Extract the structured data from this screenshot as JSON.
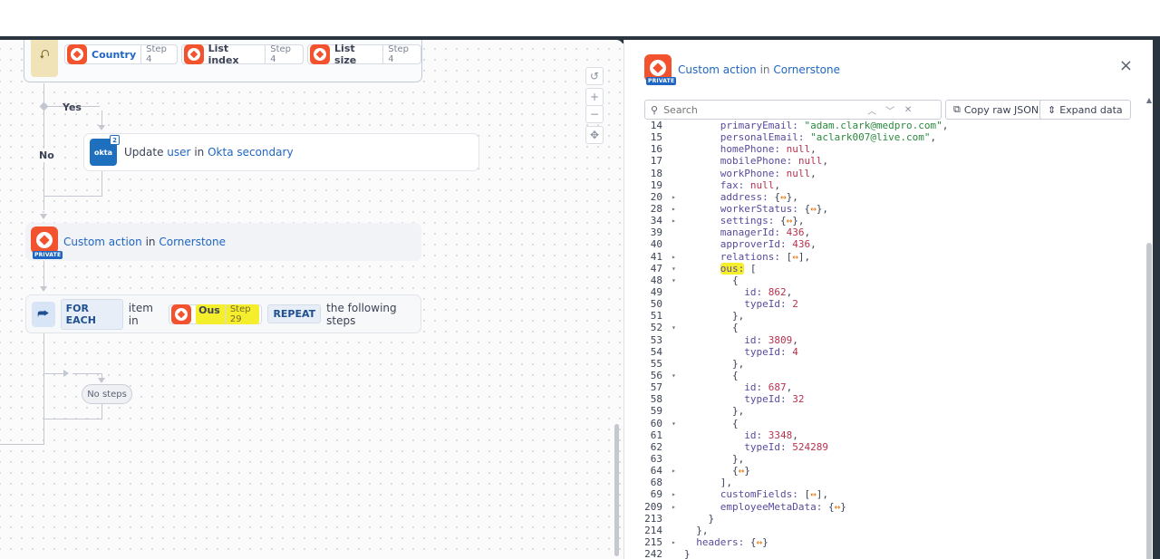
{
  "canvas": {
    "top_node": {
      "pills": [
        {
          "name": "Country",
          "step": "Step 4"
        },
        {
          "name": "List index",
          "step": "Step 4"
        },
        {
          "name": "List size",
          "step": "Step 4"
        }
      ]
    },
    "branch": {
      "yes_label": "Yes",
      "no_label": "No"
    },
    "okta_step": {
      "prefix": "Update",
      "object": "user",
      "in": "in",
      "app": "Okta secondary",
      "logo_text": "okta",
      "badge": "2"
    },
    "custom_action": {
      "prefix": "Custom action",
      "in": "in",
      "app": "Cornerstone",
      "private": "PRIVATE"
    },
    "foreach": {
      "kw1": "FOR EACH",
      "item": "item in",
      "pill_name": "Ous",
      "pill_step": "Step 29",
      "kw2": "REPEAT",
      "suffix": "the following steps"
    },
    "no_steps": "No steps",
    "controls": [
      "↺",
      "+",
      "−",
      "✥"
    ]
  },
  "panel": {
    "title_prefix": "Custom action",
    "title_in": "in",
    "title_app": "Cornerstone",
    "private": "PRIVATE",
    "search_placeholder": "Search",
    "copy_button": "Copy raw JSON",
    "expand_button": "Expand data",
    "close": "×",
    "lines": [
      {
        "n": "14",
        "t": "",
        "i": 6,
        "parts": [
          [
            "k",
            "primaryEmail: "
          ],
          [
            "s",
            "\"adam.clark@medpro.com\""
          ],
          [
            "p",
            ","
          ]
        ]
      },
      {
        "n": "15",
        "t": "",
        "i": 6,
        "parts": [
          [
            "k",
            "personalEmail: "
          ],
          [
            "s",
            "\"aclark007@live.com\""
          ],
          [
            "p",
            ","
          ]
        ]
      },
      {
        "n": "16",
        "t": "",
        "i": 6,
        "parts": [
          [
            "k",
            "homePhone: "
          ],
          [
            "n",
            "null"
          ],
          [
            "p",
            ","
          ]
        ]
      },
      {
        "n": "17",
        "t": "",
        "i": 6,
        "parts": [
          [
            "k",
            "mobilePhone: "
          ],
          [
            "n",
            "null"
          ],
          [
            "p",
            ","
          ]
        ]
      },
      {
        "n": "18",
        "t": "",
        "i": 6,
        "parts": [
          [
            "k",
            "workPhone: "
          ],
          [
            "n",
            "null"
          ],
          [
            "p",
            ","
          ]
        ]
      },
      {
        "n": "19",
        "t": "",
        "i": 6,
        "parts": [
          [
            "k",
            "fax: "
          ],
          [
            "n",
            "null"
          ],
          [
            "p",
            ","
          ]
        ]
      },
      {
        "n": "20",
        "t": "▸",
        "i": 6,
        "parts": [
          [
            "k",
            "address: "
          ],
          [
            "p",
            "{"
          ],
          [
            "o",
            "↔"
          ],
          [
            "p",
            "},"
          ]
        ]
      },
      {
        "n": "28",
        "t": "▸",
        "i": 6,
        "parts": [
          [
            "k",
            "workerStatus: "
          ],
          [
            "p",
            "{"
          ],
          [
            "o",
            "↔"
          ],
          [
            "p",
            "},"
          ]
        ]
      },
      {
        "n": "34",
        "t": "▸",
        "i": 6,
        "parts": [
          [
            "k",
            "settings: "
          ],
          [
            "p",
            "{"
          ],
          [
            "o",
            "↔"
          ],
          [
            "p",
            "},"
          ]
        ]
      },
      {
        "n": "39",
        "t": "",
        "i": 6,
        "parts": [
          [
            "k",
            "managerId: "
          ],
          [
            "n",
            "436"
          ],
          [
            "p",
            ","
          ]
        ]
      },
      {
        "n": "40",
        "t": "",
        "i": 6,
        "parts": [
          [
            "k",
            "approverId: "
          ],
          [
            "n",
            "436"
          ],
          [
            "p",
            ","
          ]
        ]
      },
      {
        "n": "41",
        "t": "▸",
        "i": 6,
        "parts": [
          [
            "k",
            "relations: "
          ],
          [
            "p",
            "["
          ],
          [
            "o",
            "↔"
          ],
          [
            "p",
            "],"
          ]
        ]
      },
      {
        "n": "47",
        "t": "▾",
        "i": 6,
        "parts": [
          [
            "h",
            "ous:"
          ],
          [
            "p",
            " ["
          ]
        ]
      },
      {
        "n": "48",
        "t": "▾",
        "i": 8,
        "parts": [
          [
            "p",
            "{"
          ]
        ]
      },
      {
        "n": "49",
        "t": "",
        "i": 10,
        "parts": [
          [
            "k",
            "id: "
          ],
          [
            "n",
            "862"
          ],
          [
            "p",
            ","
          ]
        ]
      },
      {
        "n": "50",
        "t": "",
        "i": 10,
        "parts": [
          [
            "k",
            "typeId: "
          ],
          [
            "n",
            "2"
          ]
        ]
      },
      {
        "n": "51",
        "t": "",
        "i": 8,
        "parts": [
          [
            "p",
            "},"
          ]
        ]
      },
      {
        "n": "52",
        "t": "▾",
        "i": 8,
        "parts": [
          [
            "p",
            "{"
          ]
        ]
      },
      {
        "n": "53",
        "t": "",
        "i": 10,
        "parts": [
          [
            "k",
            "id: "
          ],
          [
            "n",
            "3809"
          ],
          [
            "p",
            ","
          ]
        ]
      },
      {
        "n": "54",
        "t": "",
        "i": 10,
        "parts": [
          [
            "k",
            "typeId: "
          ],
          [
            "n",
            "4"
          ]
        ]
      },
      {
        "n": "55",
        "t": "",
        "i": 8,
        "parts": [
          [
            "p",
            "},"
          ]
        ]
      },
      {
        "n": "56",
        "t": "▾",
        "i": 8,
        "parts": [
          [
            "p",
            "{"
          ]
        ]
      },
      {
        "n": "57",
        "t": "",
        "i": 10,
        "parts": [
          [
            "k",
            "id: "
          ],
          [
            "n",
            "687"
          ],
          [
            "p",
            ","
          ]
        ]
      },
      {
        "n": "58",
        "t": "",
        "i": 10,
        "parts": [
          [
            "k",
            "typeId: "
          ],
          [
            "n",
            "32"
          ]
        ]
      },
      {
        "n": "59",
        "t": "",
        "i": 8,
        "parts": [
          [
            "p",
            "},"
          ]
        ]
      },
      {
        "n": "60",
        "t": "▾",
        "i": 8,
        "parts": [
          [
            "p",
            "{"
          ]
        ]
      },
      {
        "n": "61",
        "t": "",
        "i": 10,
        "parts": [
          [
            "k",
            "id: "
          ],
          [
            "n",
            "3348"
          ],
          [
            "p",
            ","
          ]
        ]
      },
      {
        "n": "62",
        "t": "",
        "i": 10,
        "parts": [
          [
            "k",
            "typeId: "
          ],
          [
            "n",
            "524289"
          ]
        ]
      },
      {
        "n": "63",
        "t": "",
        "i": 8,
        "parts": [
          [
            "p",
            "},"
          ]
        ]
      },
      {
        "n": "64",
        "t": "▸",
        "i": 8,
        "parts": [
          [
            "p",
            "{"
          ],
          [
            "o",
            "↔"
          ],
          [
            "p",
            "}"
          ]
        ]
      },
      {
        "n": "68",
        "t": "",
        "i": 6,
        "parts": [
          [
            "p",
            "],"
          ]
        ]
      },
      {
        "n": "69",
        "t": "▸",
        "i": 6,
        "parts": [
          [
            "k",
            "customFields: "
          ],
          [
            "p",
            "["
          ],
          [
            "o",
            "↔"
          ],
          [
            "p",
            "],"
          ]
        ]
      },
      {
        "n": "209",
        "t": "▸",
        "i": 6,
        "parts": [
          [
            "k",
            "employeeMetaData: "
          ],
          [
            "p",
            "{"
          ],
          [
            "o",
            "↔"
          ],
          [
            "p",
            "}"
          ]
        ]
      },
      {
        "n": "213",
        "t": "",
        "i": 4,
        "parts": [
          [
            "p",
            "}"
          ]
        ]
      },
      {
        "n": "214",
        "t": "",
        "i": 2,
        "parts": [
          [
            "p",
            "},"
          ]
        ]
      },
      {
        "n": "215",
        "t": "▸",
        "i": 2,
        "parts": [
          [
            "k",
            "headers: "
          ],
          [
            "p",
            "{"
          ],
          [
            "o",
            "↔"
          ],
          [
            "p",
            "}"
          ]
        ]
      },
      {
        "n": "242",
        "t": "",
        "i": 0,
        "parts": [
          [
            "p",
            "}"
          ]
        ]
      }
    ]
  }
}
